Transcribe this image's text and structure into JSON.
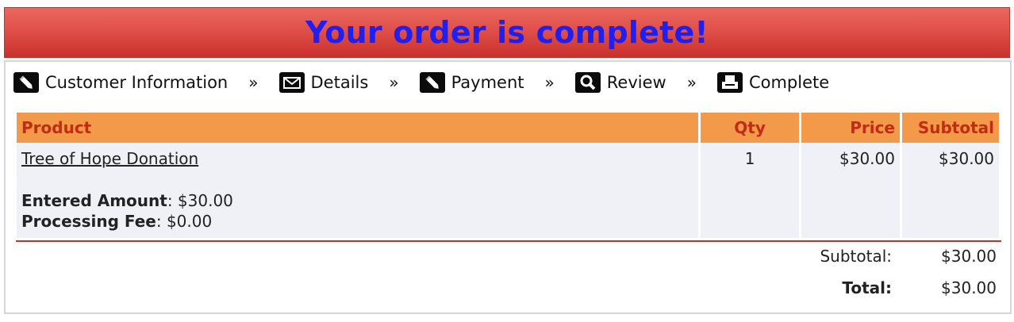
{
  "banner": {
    "title": "Your order is complete!"
  },
  "steps": [
    {
      "label": "Customer Information",
      "icon": "pencil-icon"
    },
    {
      "label": "Details",
      "icon": "envelope-icon"
    },
    {
      "label": "Payment",
      "icon": "pencil-icon"
    },
    {
      "label": "Review",
      "icon": "magnifier-icon"
    },
    {
      "label": "Complete",
      "icon": "printer-icon"
    }
  ],
  "step_separator": "»",
  "table": {
    "headers": {
      "product": "Product",
      "qty": "Qty",
      "price": "Price",
      "subtotal": "Subtotal"
    },
    "rows": [
      {
        "product": "Tree of Hope Donation",
        "qty": "1",
        "price": "$30.00",
        "subtotal": "$30.00",
        "entered_amount_label": "Entered Amount",
        "entered_amount_value": ": $30.00",
        "processing_fee_label": "Processing Fee",
        "processing_fee_value": ": $0.00"
      }
    ]
  },
  "totals": {
    "subtotal_label": "Subtotal:",
    "subtotal_value": "$30.00",
    "total_label": "Total:",
    "total_value": "$30.00"
  },
  "colors": {
    "banner_red": "#e0504a",
    "banner_title_blue": "#1f1ff2",
    "header_orange": "#f2994a",
    "header_text_red": "#c42b17",
    "row_bg": "#f0f1f6",
    "divider_red": "#b1392d"
  }
}
